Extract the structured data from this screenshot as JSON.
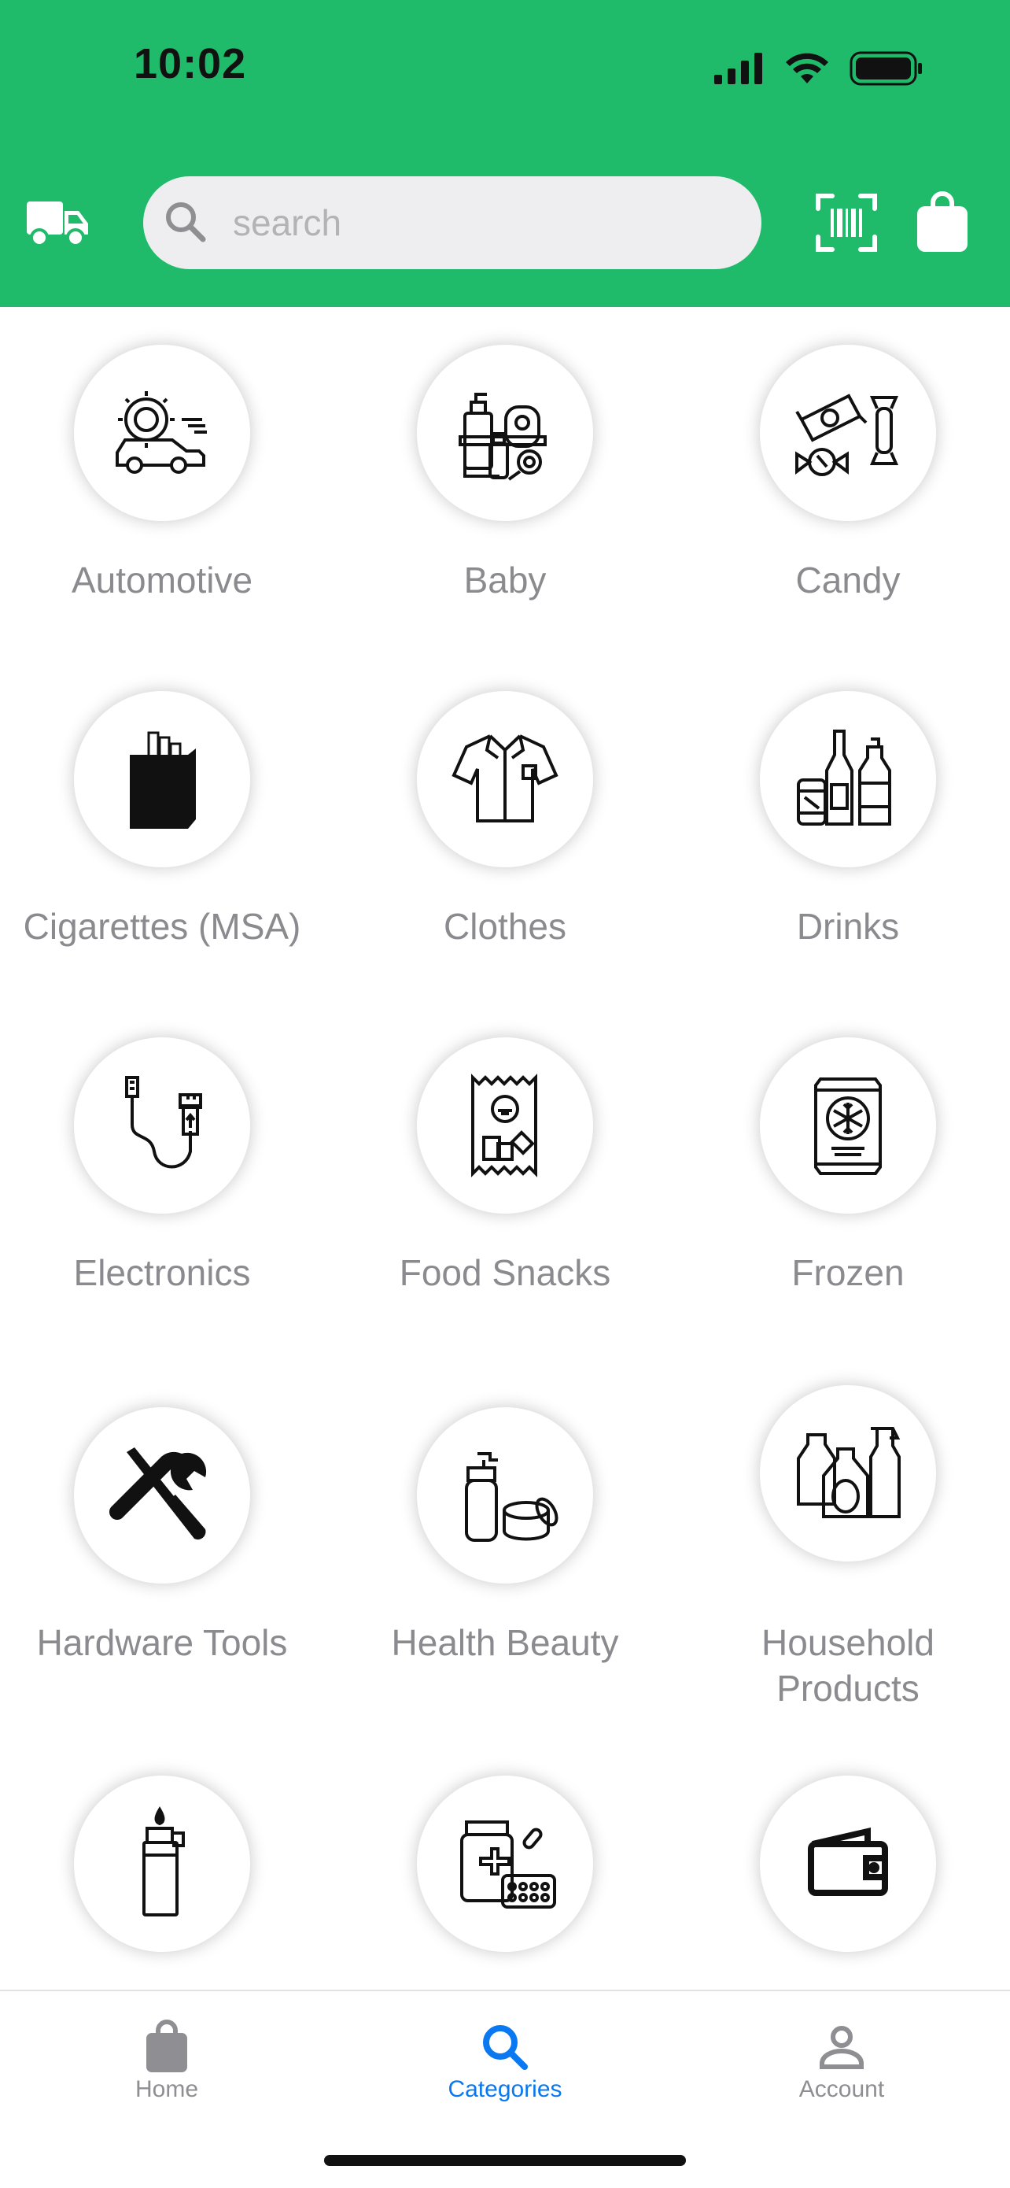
{
  "status": {
    "time": "10:02"
  },
  "header": {
    "search_placeholder": "search",
    "icons": [
      "truck-icon",
      "search-icon",
      "barcode-scan-icon",
      "shopping-bag-icon"
    ],
    "background_color": "#20bb6a"
  },
  "categories": [
    {
      "label": "Automotive",
      "icon": "automotive-icon"
    },
    {
      "label": "Baby",
      "icon": "baby-products-icon"
    },
    {
      "label": "Candy",
      "icon": "candy-icon"
    },
    {
      "label": "Cigarettes (MSA)",
      "icon": "cigarette-pack-icon"
    },
    {
      "label": "Clothes",
      "icon": "shirt-icon"
    },
    {
      "label": "Drinks",
      "icon": "bottles-icon"
    },
    {
      "label": "Electronics",
      "icon": "usb-cable-icon"
    },
    {
      "label": "Food  Snacks",
      "icon": "snack-bag-icon"
    },
    {
      "label": "Frozen",
      "icon": "frozen-bag-icon"
    },
    {
      "label": "Hardware  Tools",
      "icon": "tools-icon"
    },
    {
      "label": "Health  Beauty",
      "icon": "cosmetics-icon"
    },
    {
      "label": "Household\nProducts",
      "icon": "cleaning-products-icon"
    },
    {
      "label": "",
      "icon": "lighter-icon"
    },
    {
      "label": "",
      "icon": "medicine-icon"
    },
    {
      "label": "",
      "icon": "wallet-icon"
    }
  ],
  "tabbar": {
    "tabs": [
      {
        "label": "Home",
        "icon": "bag-icon",
        "active": false
      },
      {
        "label": "Categories",
        "icon": "search-icon",
        "active": true
      },
      {
        "label": "Account",
        "icon": "person-icon",
        "active": false
      }
    ],
    "active_color": "#0a78f0"
  }
}
